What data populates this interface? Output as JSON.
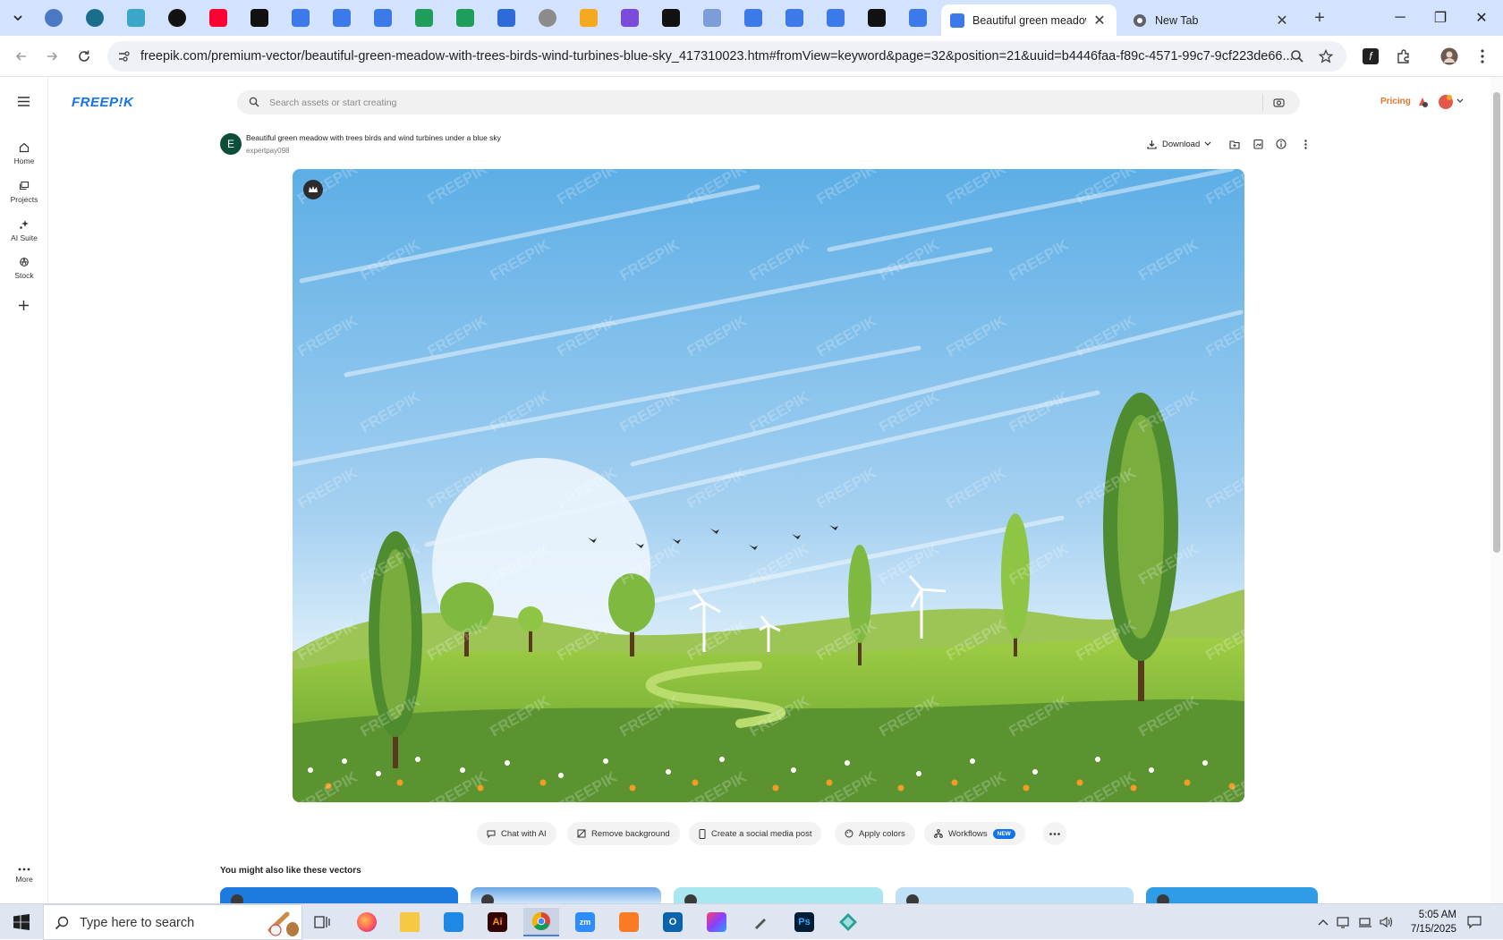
{
  "browser": {
    "tabs": [
      {
        "title": "Beautiful green meadow",
        "active": true
      },
      {
        "title": "New Tab",
        "active": false
      }
    ],
    "address": {
      "url": "freepik.com/premium-vector/beautiful-green-meadow-with-trees-birds-wind-turbines-blue-sky_417310023.htm#fromView=keyword&page=32&position=21&uuid=b4446faa-f89c-4571-99c7-9cf223de66..."
    }
  },
  "rail": {
    "items": [
      {
        "label": "Home",
        "icon": "home-icon"
      },
      {
        "label": "Projects",
        "icon": "projects-icon"
      },
      {
        "label": "AI Suite",
        "icon": "ai-suite-icon"
      },
      {
        "label": "Stock",
        "icon": "stock-icon"
      }
    ],
    "add_icon": "plus-icon",
    "more_label": "More"
  },
  "header": {
    "logo": "FREEP!K",
    "search_placeholder": "Search assets or start creating",
    "pricing_label": "Pricing"
  },
  "asset": {
    "avatar_letter": "E",
    "title": "Beautiful green meadow with trees birds and wind turbines under a blue sky",
    "author": "expertpay098",
    "download_label": "Download",
    "watermark_text": "FREEPIK"
  },
  "actions": [
    {
      "label": "Chat with AI",
      "icon": "chat-icon"
    },
    {
      "label": "Remove background",
      "icon": "remove-bg-icon"
    },
    {
      "label": "Create a social media post",
      "icon": "phone-icon"
    },
    {
      "label": "Apply colors",
      "icon": "palette-icon"
    },
    {
      "label": "Workflows",
      "icon": "workflow-icon",
      "badge": "NEW"
    }
  ],
  "related": {
    "title": "You might also like these vectors"
  },
  "taskbar": {
    "search_placeholder": "Type here to search",
    "time": "5:05 AM",
    "date": "7/15/2025"
  },
  "colors": {
    "brand": "#1273eb",
    "pricing": "#e0782e",
    "tabstrip": "#d3e3fd"
  }
}
